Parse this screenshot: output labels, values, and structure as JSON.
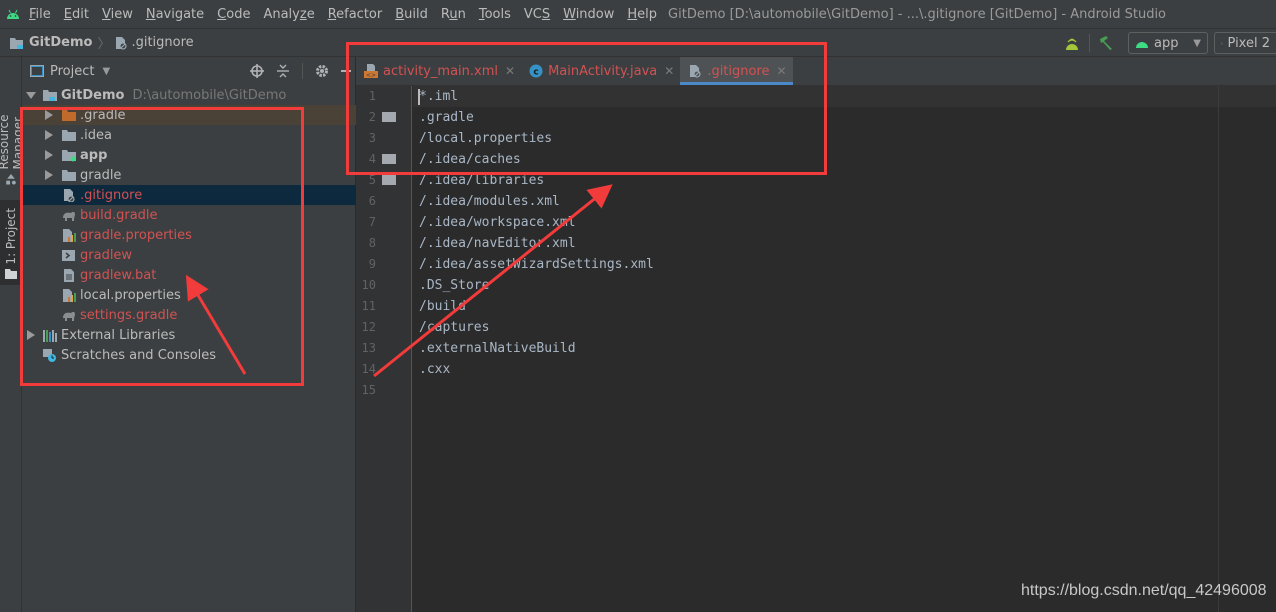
{
  "menubar": {
    "items": [
      "File",
      "Edit",
      "View",
      "Navigate",
      "Code",
      "Analyze",
      "Refactor",
      "Build",
      "Run",
      "Tools",
      "VCS",
      "Window",
      "Help"
    ],
    "mnemonics": [
      "F",
      "E",
      "V",
      "N",
      "C",
      "z",
      "R",
      "B",
      "u",
      "T",
      "S",
      "W",
      "H"
    ],
    "window_title": "GitDemo [D:\\automobile\\GitDemo] - ...\\.gitignore [GitDemo] - Android Studio"
  },
  "breadcrumb": {
    "project": "GitDemo",
    "file": ".gitignore"
  },
  "toolbar": {
    "run_config": "app",
    "device": "Pixel 2"
  },
  "left_strip": {
    "resource_manager": "Resource Manager",
    "project_tab": "1: Project"
  },
  "project_panel": {
    "title": "Project",
    "root": {
      "name": "GitDemo",
      "path": "D:\\automobile\\GitDemo"
    },
    "items": [
      {
        "name": ".gradle",
        "type": "folder-excluded",
        "expandable": true,
        "vcs": "normal"
      },
      {
        "name": ".idea",
        "type": "folder",
        "expandable": true,
        "vcs": "normal"
      },
      {
        "name": "app",
        "type": "module",
        "expandable": true,
        "vcs": "normal"
      },
      {
        "name": "gradle",
        "type": "folder",
        "expandable": true,
        "vcs": "normal"
      },
      {
        "name": ".gitignore",
        "type": "gitignore",
        "expandable": false,
        "vcs": "unversioned",
        "selected": true
      },
      {
        "name": "build.gradle",
        "type": "gradle",
        "expandable": false,
        "vcs": "unversioned"
      },
      {
        "name": "gradle.properties",
        "type": "properties",
        "expandable": false,
        "vcs": "unversioned"
      },
      {
        "name": "gradlew",
        "type": "shell",
        "expandable": false,
        "vcs": "unversioned"
      },
      {
        "name": "gradlew.bat",
        "type": "text",
        "expandable": false,
        "vcs": "unversioned"
      },
      {
        "name": "local.properties",
        "type": "properties",
        "expandable": false,
        "vcs": "normal"
      },
      {
        "name": "settings.gradle",
        "type": "gradle",
        "expandable": false,
        "vcs": "unversioned"
      }
    ],
    "external_libraries": "External Libraries",
    "scratches": "Scratches and Consoles"
  },
  "editor": {
    "tabs": [
      {
        "label": "activity_main.xml",
        "icon": "xml-layout-icon",
        "active": false
      },
      {
        "label": "MainActivity.java",
        "icon": "java-class-icon",
        "active": false
      },
      {
        "label": ".gitignore",
        "icon": "gitignore-file-icon",
        "active": true
      }
    ],
    "lines": [
      "*.iml",
      ".gradle",
      "/local.properties",
      "/.idea/caches",
      "/.idea/libraries",
      "/.idea/modules.xml",
      "/.idea/workspace.xml",
      "/.idea/navEditor.xml",
      "/.idea/assetWizardSettings.xml",
      ".DS_Store",
      "/build",
      "/captures",
      ".externalNativeBuild",
      ".cxx",
      ""
    ],
    "line_numbers": [
      "1",
      "2",
      "3",
      "4",
      "5",
      "6",
      "7",
      "8",
      "9",
      "10",
      "11",
      "12",
      "13",
      "14",
      "15"
    ],
    "folder_markers_on_lines": [
      2,
      4,
      5
    ]
  },
  "watermark": "https://blog.csdn.net/qq_42496008",
  "colors": {
    "annotation_red": "#f23b3b",
    "unversioned_file": "#d25252",
    "active_tab_underline": "#4a88c7",
    "selection": "#0d293e"
  }
}
